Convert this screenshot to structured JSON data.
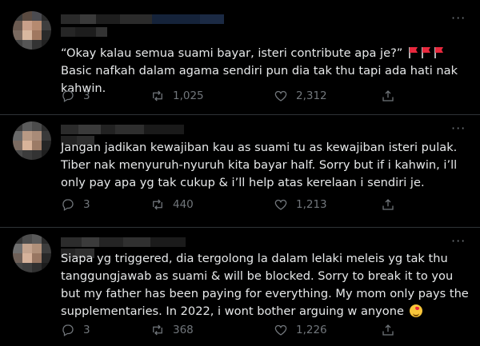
{
  "more_glyph": "···",
  "tweets": [
    {
      "text_before_flags": "“Okay kalau semua suami bayar, isteri contribute apa je?” ",
      "text_after_flags": " Basic nafkah dalam agama sendiri pun dia tak thu tapi ada hati nak kahwin.",
      "flag_emoji": "red-triangular-flag",
      "reply_count": "3",
      "retweet_count": "1,025",
      "like_count": "2,312"
    },
    {
      "text": "Jangan jadikan kewajiban kau as suami tu as kewajiban isteri pulak. Tiber nak menyuruh-nyuruh kita bayar half. Sorry but if i kahwin, i’ll only pay apa yg tak cukup & i’ll help atas kerelaan i sendiri je.",
      "reply_count": "3",
      "retweet_count": "440",
      "like_count": "1,213"
    },
    {
      "text": "Siapa yg triggered, dia tergolong la dalam lelaki meleis yg tak thu tanggungjawab as suami & will be blocked. Sorry to break it to you but my father has been paying for everything. My mom only pays the supplementaries. In 2022, i wont bother arguing w anyone ",
      "end_emoji": "smiling-face-with-hearts",
      "reply_count": "3",
      "retweet_count": "368",
      "like_count": "1,226"
    }
  ],
  "icons": [
    "reply-icon",
    "retweet-icon",
    "like-icon",
    "share-icon",
    "more-icon"
  ]
}
